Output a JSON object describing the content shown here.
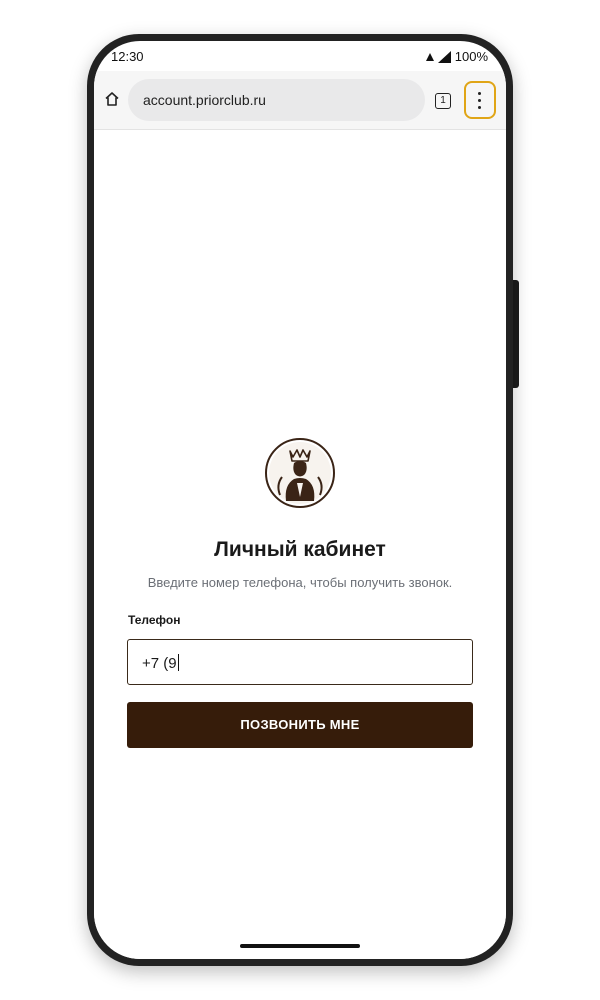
{
  "status_bar": {
    "time": "12:30",
    "battery": "100%"
  },
  "browser": {
    "url": "account.priorclub.ru",
    "tab_count": "1"
  },
  "page": {
    "title": "Личный кабинет",
    "subtitle": "Введите номер телефона, чтобы получить звонок.",
    "phone_label": "Телефон",
    "phone_value": "+7 (9",
    "call_button": "ПОЗВОНИТЬ МНЕ"
  },
  "colors": {
    "button": "#361c0a",
    "menu_highlight": "#e0a516",
    "subtitle": "#6b6f76"
  }
}
